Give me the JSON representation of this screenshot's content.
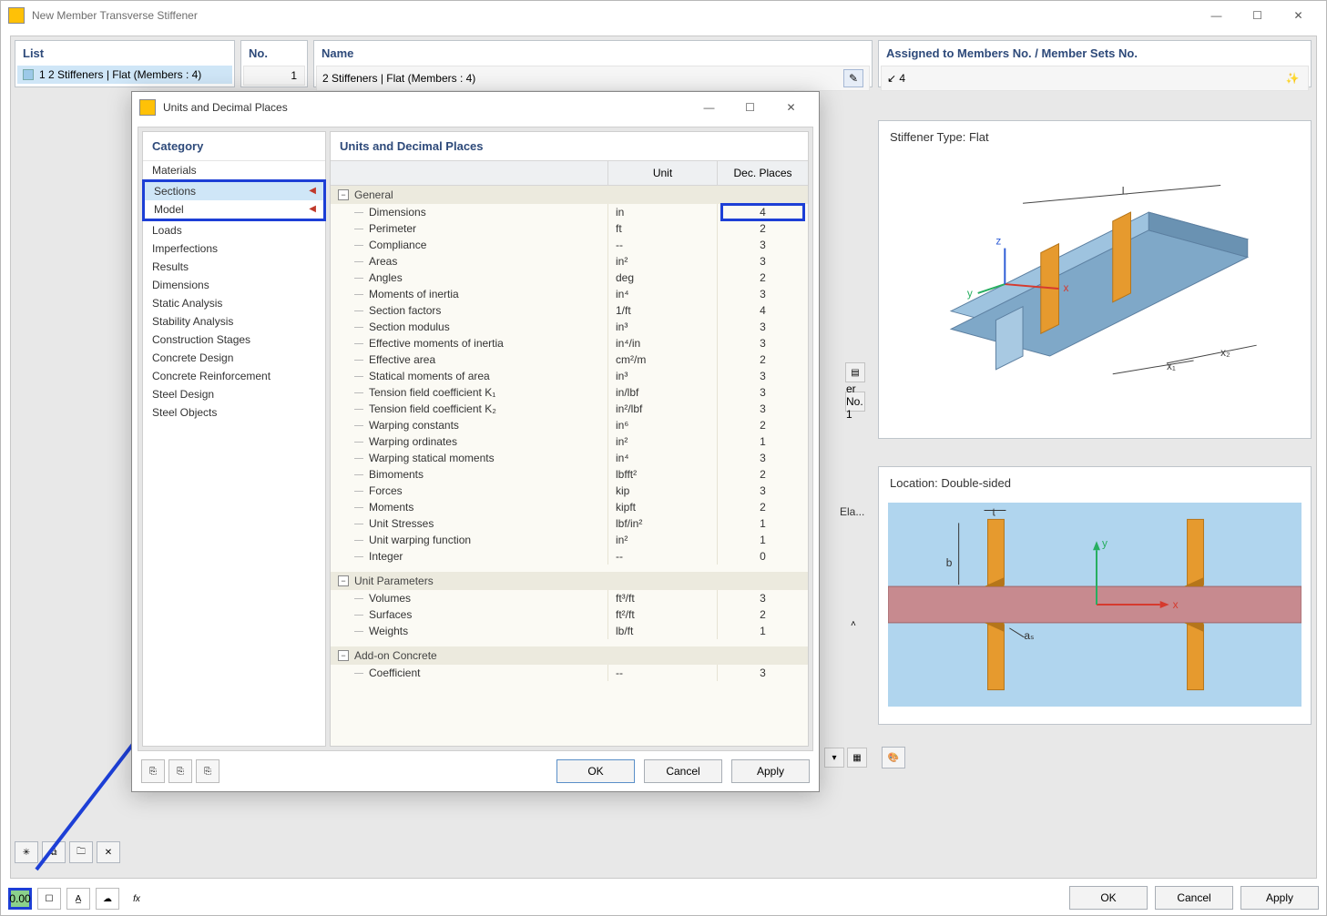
{
  "main_window": {
    "title": "New Member Transverse Stiffener"
  },
  "panels": {
    "list": {
      "header": "List",
      "item": "1 2 Stiffeners | Flat (Members : 4)"
    },
    "no": {
      "header": "No.",
      "value": "1"
    },
    "name": {
      "header": "Name",
      "value": "2 Stiffeners | Flat (Members : 4)"
    },
    "assigned": {
      "header": "Assigned to Members No. / Member Sets No.",
      "value": "↙ 4"
    },
    "right1": {
      "header": "Stiffener Type: Flat"
    },
    "right2": {
      "header": "Location: Double-sided"
    },
    "peek1": "er No. 1",
    "peek2": "Ela..."
  },
  "main_buttons": {
    "ok": "OK",
    "cancel": "Cancel",
    "apply": "Apply"
  },
  "status_icon_label": "0.00",
  "modal": {
    "title": "Units and Decimal Places",
    "category_header": "Category",
    "categories": [
      "Materials",
      "Sections",
      "Model",
      "Loads",
      "Imperfections",
      "Results",
      "Dimensions",
      "Static Analysis",
      "Stability Analysis",
      "Construction Stages",
      "Concrete Design",
      "Concrete Reinforcement",
      "Steel Design",
      "Steel Objects"
    ],
    "table_header": "Units and Decimal Places",
    "col_unit": "Unit",
    "col_dec": "Dec. Places",
    "groups": {
      "general": "General",
      "unitparams": "Unit Parameters",
      "addon": "Add-on Concrete"
    },
    "general_rows": [
      {
        "name": "Dimensions",
        "unit": "in",
        "dec": "4"
      },
      {
        "name": "Perimeter",
        "unit": "ft",
        "dec": "2"
      },
      {
        "name": "Compliance",
        "unit": "--",
        "dec": "3"
      },
      {
        "name": "Areas",
        "unit": "in²",
        "dec": "3"
      },
      {
        "name": "Angles",
        "unit": "deg",
        "dec": "2"
      },
      {
        "name": "Moments of inertia",
        "unit": "in⁴",
        "dec": "3"
      },
      {
        "name": "Section factors",
        "unit": "1/ft",
        "dec": "4"
      },
      {
        "name": "Section modulus",
        "unit": "in³",
        "dec": "3"
      },
      {
        "name": "Effective moments of inertia",
        "unit": "in⁴/in",
        "dec": "3"
      },
      {
        "name": "Effective area",
        "unit": "cm²/m",
        "dec": "2"
      },
      {
        "name": "Statical moments of area",
        "unit": "in³",
        "dec": "3"
      },
      {
        "name": "Tension field coefficient K₁",
        "unit": "in/lbf",
        "dec": "3"
      },
      {
        "name": "Tension field coefficient K₂",
        "unit": "in²/lbf",
        "dec": "3"
      },
      {
        "name": "Warping constants",
        "unit": "in⁶",
        "dec": "2"
      },
      {
        "name": "Warping ordinates",
        "unit": "in²",
        "dec": "1"
      },
      {
        "name": "Warping statical moments",
        "unit": "in⁴",
        "dec": "3"
      },
      {
        "name": "Bimoments",
        "unit": "lbfft²",
        "dec": "2"
      },
      {
        "name": "Forces",
        "unit": "kip",
        "dec": "3"
      },
      {
        "name": "Moments",
        "unit": "kipft",
        "dec": "2"
      },
      {
        "name": "Unit Stresses",
        "unit": "lbf/in²",
        "dec": "1"
      },
      {
        "name": "Unit warping function",
        "unit": "in²",
        "dec": "1"
      },
      {
        "name": "Integer",
        "unit": "--",
        "dec": "0"
      }
    ],
    "unitparam_rows": [
      {
        "name": "Volumes",
        "unit": "ft³/ft",
        "dec": "3"
      },
      {
        "name": "Surfaces",
        "unit": "ft²/ft",
        "dec": "2"
      },
      {
        "name": "Weights",
        "unit": "lb/ft",
        "dec": "1"
      }
    ],
    "addon_rows": [
      {
        "name": "Coefficient",
        "unit": "--",
        "dec": "3"
      }
    ],
    "buttons": {
      "ok": "OK",
      "cancel": "Cancel",
      "apply": "Apply"
    }
  }
}
